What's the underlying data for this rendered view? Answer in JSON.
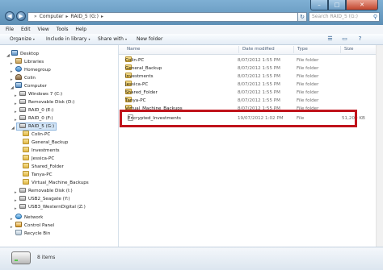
{
  "address": {
    "segments": [
      "Computer",
      "RAID_5 (G:)"
    ],
    "refresh_icon": "refresh-icon"
  },
  "search": {
    "placeholder": "Search RAID_5 (G:)"
  },
  "window_controls": {
    "minimize": "–",
    "maximize": "□",
    "close": "✕"
  },
  "nav_glyphs": {
    "back": "◀",
    "forward": "▶",
    "dropdown": "▾",
    "expand": "▸",
    "expanded": "◢"
  },
  "menu": [
    "File",
    "Edit",
    "View",
    "Tools",
    "Help"
  ],
  "toolbar": {
    "organize": "Organize",
    "include": "Include in library",
    "share": "Share with",
    "new_folder": "New folder"
  },
  "sidebar": {
    "items": [
      {
        "label": "Desktop",
        "icon": "desktop-icon"
      },
      {
        "label": "Libraries",
        "icon": "libraries-icon"
      },
      {
        "label": "Homegroup",
        "icon": "homegroup-icon"
      },
      {
        "label": "Colin",
        "icon": "user-icon"
      },
      {
        "label": "Computer",
        "icon": "computer-icon"
      },
      {
        "label": "Windows 7 (C:)",
        "icon": "drive-icon"
      },
      {
        "label": "Removable Disk (D:)",
        "icon": "drive-icon"
      },
      {
        "label": "RAID_0 (E:)",
        "icon": "drive-icon"
      },
      {
        "label": "RAID_0 (F:)",
        "icon": "drive-icon"
      },
      {
        "label": "RAID_5 (G:)",
        "icon": "drive-icon"
      },
      {
        "label": "Colin-PC",
        "icon": "folder-icon"
      },
      {
        "label": "General_Backup",
        "icon": "folder-icon"
      },
      {
        "label": "Investments",
        "icon": "folder-icon"
      },
      {
        "label": "Jessica-PC",
        "icon": "folder-icon"
      },
      {
        "label": "Shared_Folder",
        "icon": "folder-icon"
      },
      {
        "label": "Tanya-PC",
        "icon": "folder-icon"
      },
      {
        "label": "Virtual_Machine_Backups",
        "icon": "folder-icon"
      },
      {
        "label": "Removable Disk (I:)",
        "icon": "drive-icon"
      },
      {
        "label": "USB2_Seagate (Y:)",
        "icon": "drive-icon"
      },
      {
        "label": "USB3_WesternDigital (Z:)",
        "icon": "drive-icon"
      },
      {
        "label": "Network",
        "icon": "network-icon"
      },
      {
        "label": "Control Panel",
        "icon": "control-panel-icon"
      },
      {
        "label": "Recycle Bin",
        "icon": "recycle-bin-icon"
      }
    ]
  },
  "columns": {
    "name": "Name",
    "date": "Date modified",
    "type": "Type",
    "size": "Size"
  },
  "files": [
    {
      "name": "Colin-PC",
      "date": "8/07/2012 1:55 PM",
      "type": "File folder",
      "size": "",
      "icon": "folder-icon"
    },
    {
      "name": "General_Backup",
      "date": "8/07/2012 1:55 PM",
      "type": "File folder",
      "size": "",
      "icon": "folder-icon"
    },
    {
      "name": "Investments",
      "date": "8/07/2012 1:55 PM",
      "type": "File folder",
      "size": "",
      "icon": "folder-icon"
    },
    {
      "name": "Jessica-PC",
      "date": "8/07/2012 1:55 PM",
      "type": "File folder",
      "size": "",
      "icon": "folder-icon"
    },
    {
      "name": "Shared_Folder",
      "date": "8/07/2012 1:55 PM",
      "type": "File folder",
      "size": "",
      "icon": "folder-icon"
    },
    {
      "name": "Tanya-PC",
      "date": "8/07/2012 1:55 PM",
      "type": "File folder",
      "size": "",
      "icon": "folder-icon"
    },
    {
      "name": "Virtual_Machine_Backups",
      "date": "8/07/2012 1:55 PM",
      "type": "File folder",
      "size": "",
      "icon": "folder-icon"
    },
    {
      "name": "Encrypted_Investments",
      "date": "19/07/2012 1:02 PM",
      "type": "File",
      "size": "51,200 KB",
      "icon": "file-icon"
    }
  ],
  "status": {
    "count": "8 items"
  },
  "colors": {
    "highlight": "#c0131b",
    "titlebar": "#6e9fc6"
  }
}
